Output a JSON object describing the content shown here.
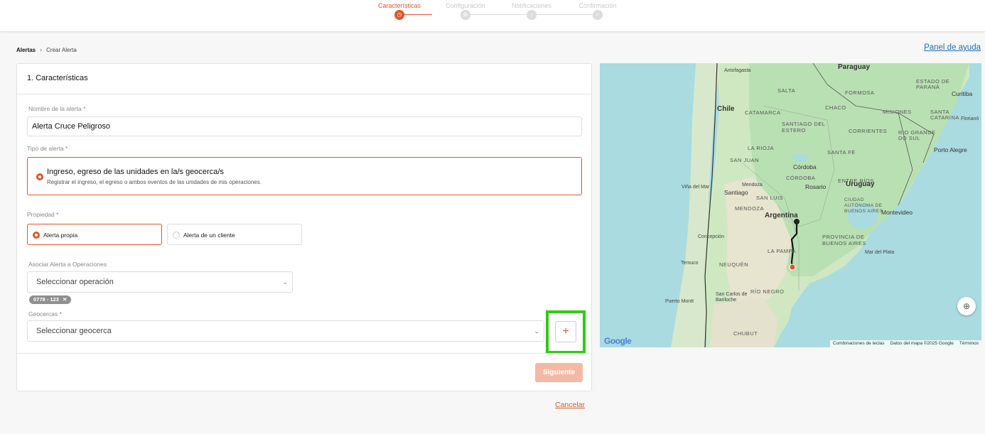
{
  "stepper": {
    "steps": [
      {
        "label": "Características",
        "icon": "clock-icon",
        "active": true
      },
      {
        "label": "Configuración",
        "icon": "gear-icon",
        "active": false
      },
      {
        "label": "Notificaciones",
        "icon": "bell-icon",
        "active": false
      },
      {
        "label": "Confirmación",
        "icon": "check-icon",
        "active": false
      }
    ]
  },
  "breadcrumb": {
    "root": "Alertas",
    "separator": "›",
    "current": "Crear Alerta"
  },
  "help_link": "Panel de ayuda",
  "form": {
    "section_title": "1. Características",
    "name_label": "Nombre de la alerta *",
    "name_value": "Alerta Cruce Peligroso",
    "type_label": "Tipo de alerta *",
    "type_option_title": "Ingreso, egreso de las unidades en la/s geocerca/s",
    "type_option_desc": "Registrar el ingreso, el egreso o ambos eventos de las unidades de mis operaciones.",
    "property_label": "Propiedad *",
    "property_options": [
      "Alerta propia",
      "Alerta de un cliente"
    ],
    "operations_label": "Asociar Alerta a Operaciones",
    "operations_placeholder": "Seleccionar operación",
    "operation_chip": "0778 - 123",
    "chip_remove": "✕",
    "geofence_label": "Geocercas *",
    "geofence_placeholder": "Seleccionar geocerca",
    "add_geofence": "+",
    "next_label": "Siguiente",
    "cancel_label": "Cancelar"
  },
  "colors": {
    "accent": "#e0552a",
    "highlight": "#2ecc12",
    "link": "#1e6fb8"
  },
  "map": {
    "countries": [
      "Paraguay",
      "Chile",
      "Argentina",
      "Uruguay"
    ],
    "cities": [
      "Antofagasta",
      "Curitiba",
      "Florianó",
      "Porto Alegre",
      "Córdoba",
      "Rosario",
      "Mendoza",
      "Santiago",
      "Viña del Mar",
      "Montevideo",
      "Concepción",
      "Temuco",
      "Mar del Plata",
      "Puerto Montt",
      "San Carlos de Bariloche"
    ],
    "regions": [
      "SALTA",
      "FORMOSA",
      "CHACO",
      "CATAMARCA",
      "SANTIAGO DEL ESTERO",
      "MISIONES",
      "CORRIENTES",
      "LA RIOJA",
      "SANTA FE",
      "SAN JUAN",
      "CÓRDOBA",
      "ENTRE RÍOS",
      "SAN LUIS",
      "MENDOZA",
      "PROVINCIA DE BUENOS AIRES",
      "CIUDAD AUTÓNOMA DE BUENOS AIRES",
      "LA PAMPA",
      "NEUQUÉN",
      "RÍO NEGRO",
      "CHUBUT",
      "ESTADO DE PARANÁ",
      "SANTA CATARINA",
      "RIO GRANDE DO SUL"
    ],
    "footer": [
      "Combinaciones de teclas",
      "Datos del mapa ©2025 Google",
      "Términos"
    ],
    "logo": "Google"
  }
}
